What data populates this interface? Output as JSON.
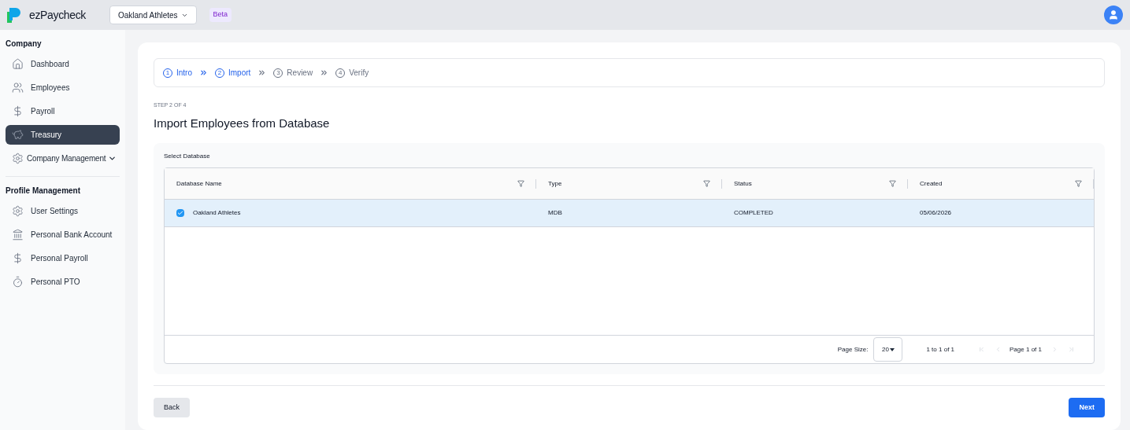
{
  "header": {
    "brand": "ezPaycheck",
    "company_selector": "Oakland Athletes",
    "badge": "Beta"
  },
  "sidebar": {
    "sections": [
      {
        "title": "Company",
        "items": [
          {
            "label": "Dashboard",
            "selected": false,
            "kind": "link"
          },
          {
            "label": "Employees",
            "selected": false,
            "kind": "link"
          },
          {
            "label": "Payroll",
            "selected": false,
            "kind": "link"
          },
          {
            "label": "Treasury",
            "selected": true,
            "kind": "link"
          },
          {
            "label": "Company Management",
            "selected": false,
            "kind": "group",
            "expanded": false
          }
        ]
      },
      {
        "title": "Profile Management",
        "items": [
          {
            "label": "User Settings",
            "selected": false,
            "kind": "link"
          },
          {
            "label": "Personal Bank Account",
            "selected": false,
            "kind": "link"
          },
          {
            "label": "Personal Payroll",
            "selected": false,
            "kind": "link"
          },
          {
            "label": "Personal PTO",
            "selected": false,
            "kind": "link"
          }
        ]
      }
    ]
  },
  "steps": [
    {
      "number": "1",
      "label": "Intro",
      "reached": true
    },
    {
      "number": "2",
      "label": "Import",
      "reached": true
    },
    {
      "number": "3",
      "label": "Review",
      "reached": false
    },
    {
      "number": "4",
      "label": "Verify",
      "reached": false
    }
  ],
  "step_caption": "STEP 2 OF 4",
  "title": "Import Employees from Database",
  "panel_label": "Select Database",
  "table": {
    "columns": [
      "Database Name",
      "Type",
      "Status",
      "Created"
    ],
    "rows": [
      {
        "cells": [
          "Oakland Athletes",
          "MDB",
          "COMPLETED",
          "05/06/2026"
        ],
        "selected": true
      }
    ],
    "pagination": {
      "page_size_label": "Page Size:",
      "page_size": "20",
      "range": "1 to 1 of 1",
      "page_prefix": "Page",
      "page": "1",
      "page_of": "of",
      "page_total": "1"
    }
  },
  "buttons": {
    "back": "Back",
    "next": "Next"
  }
}
